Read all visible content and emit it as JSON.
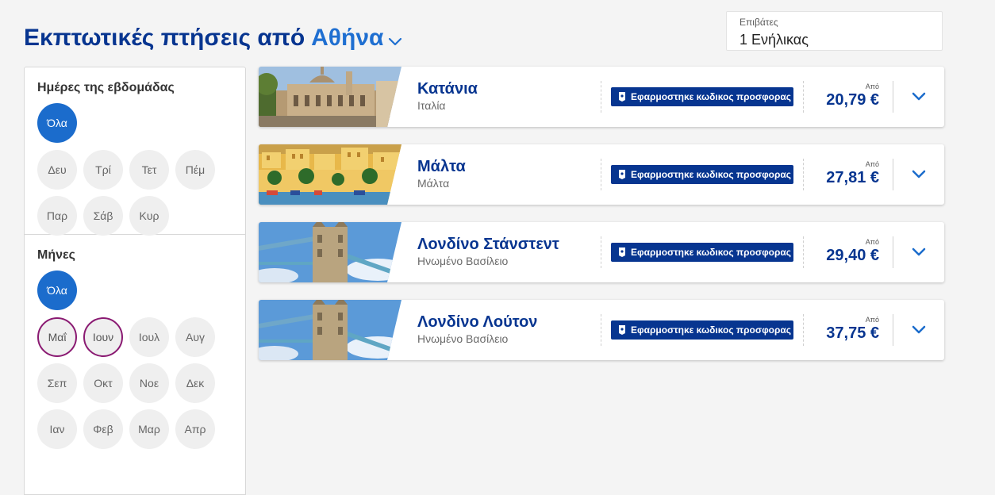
{
  "header": {
    "title_prefix": "Εκπτωτικές πτήσεις από",
    "origin_city": "Αθήνα",
    "origin_icon": "chevron-down-icon"
  },
  "passengers": {
    "label": "Επιβάτες",
    "value": "1 Ενήλικας"
  },
  "filters": {
    "weekdays": {
      "heading": "Ημέρες της εβδομάδας",
      "all": "Όλα",
      "days": [
        "Δευ",
        "Τρί",
        "Τετ",
        "Πέμ",
        "Παρ",
        "Σάβ",
        "Κυρ"
      ]
    },
    "months": {
      "heading": "Μήνες",
      "all": "Όλα",
      "items": [
        "Μαΐ",
        "Ιουν",
        "Ιουλ",
        "Αυγ",
        "Σεπ",
        "Οκτ",
        "Νοε",
        "Δεκ",
        "Ιαν",
        "Φεβ",
        "Μαρ",
        "Απρ"
      ],
      "selected": [
        "Μαΐ",
        "Ιουν"
      ]
    }
  },
  "colors": {
    "brand_dark": "#073590",
    "brand_blue": "#1b6ccc",
    "selected_ring": "#8a1a72"
  },
  "results": [
    {
      "destination": "Κατάνια",
      "country": "Ιταλία",
      "promo": "Εφαρμοστηκε κωδικος προσφορας",
      "from_label": "Από",
      "price": "20,79 €",
      "image": "catania-cathedral"
    },
    {
      "destination": "Μάλτα",
      "country": "Μάλτα",
      "promo": "Εφαρμοστηκε κωδικος προσφορας",
      "from_label": "Από",
      "price": "27,81 €",
      "image": "malta-harbour"
    },
    {
      "destination": "Λονδίνο Στάνστεντ",
      "country": "Ηνωμένο Βασίλειο",
      "promo": "Εφαρμοστηκε κωδικος προσφορας",
      "from_label": "Από",
      "price": "29,40 €",
      "image": "tower-bridge"
    },
    {
      "destination": "Λονδίνο Λούτον",
      "country": "Ηνωμένο Βασίλειο",
      "promo": "Εφαρμοστηκε κωδικος προσφορας",
      "from_label": "Από",
      "price": "37,75 €",
      "image": "tower-bridge"
    }
  ]
}
